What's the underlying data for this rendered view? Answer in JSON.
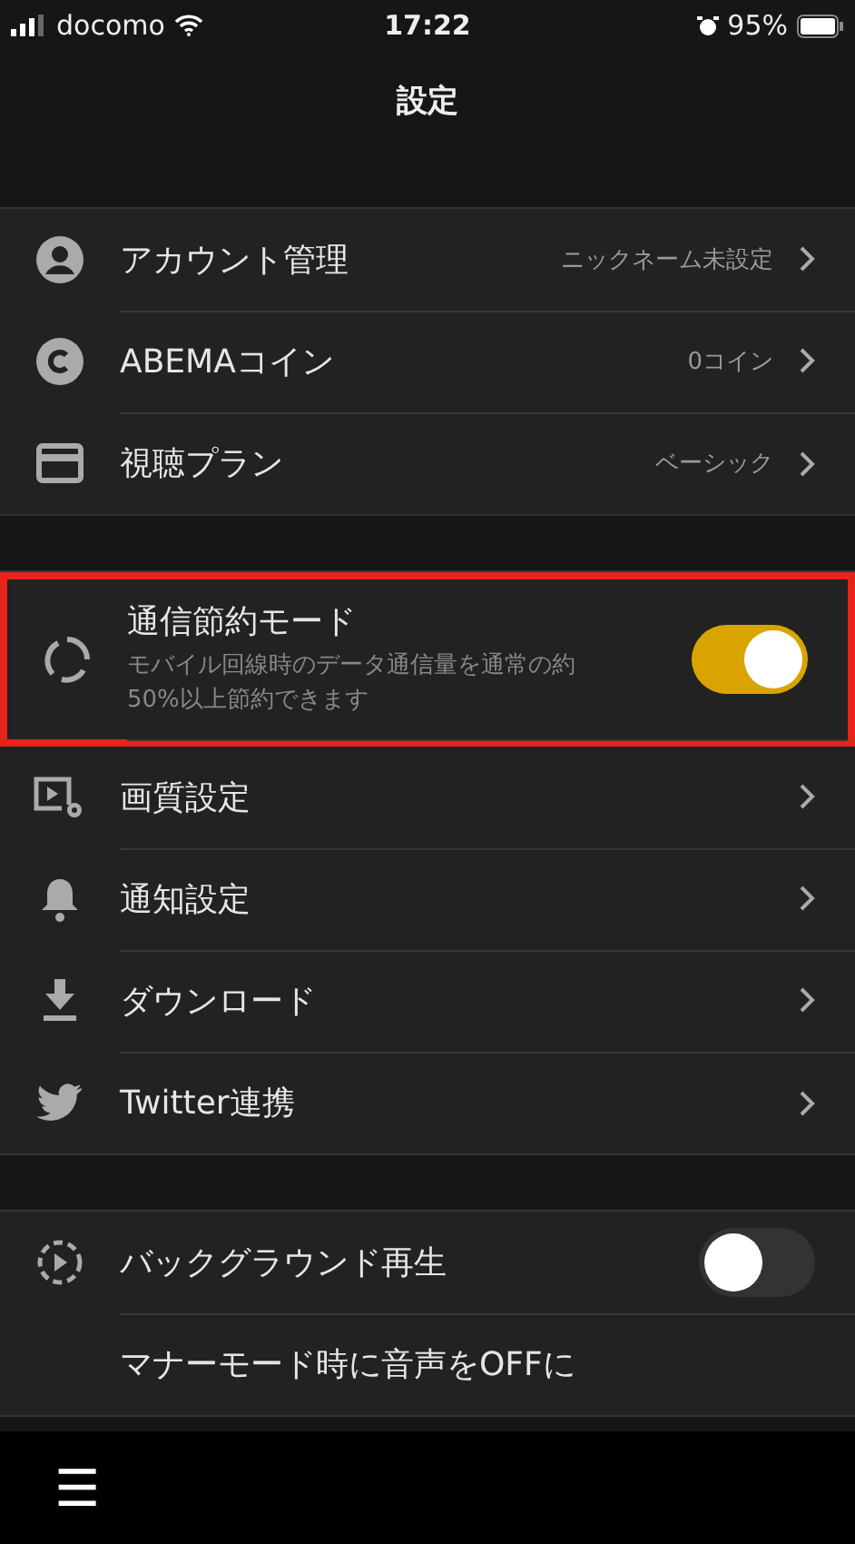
{
  "status_bar": {
    "carrier": "docomo",
    "time": "17:22",
    "battery": "95%"
  },
  "header": {
    "title": "設定"
  },
  "sections": [
    {
      "items": [
        {
          "kind": "link",
          "label": "アカウント管理",
          "value": "ニックネーム未設定"
        },
        {
          "kind": "link",
          "label": "ABEMAコイン",
          "value": "0コイン"
        },
        {
          "kind": "link",
          "label": "視聴プラン",
          "value": "ベーシック"
        }
      ]
    },
    {
      "items": [
        {
          "kind": "toggle",
          "label": "通信節約モード",
          "description": "モバイル回線時のデータ通信量を通常の約50%以上節約できます",
          "on": true,
          "highlighted": true
        },
        {
          "kind": "link",
          "label": "画質設定"
        },
        {
          "kind": "link",
          "label": "通知設定"
        },
        {
          "kind": "link",
          "label": "ダウンロード"
        },
        {
          "kind": "link",
          "label": "Twitter連携"
        }
      ]
    },
    {
      "items": [
        {
          "kind": "toggle",
          "label": "バックグラウンド再生",
          "on": false,
          "highlighted": false
        },
        {
          "kind": "plain",
          "label": "マナーモード時に音声をOFFに"
        }
      ]
    }
  ],
  "tab_bar": {
    "menu": "☰"
  }
}
